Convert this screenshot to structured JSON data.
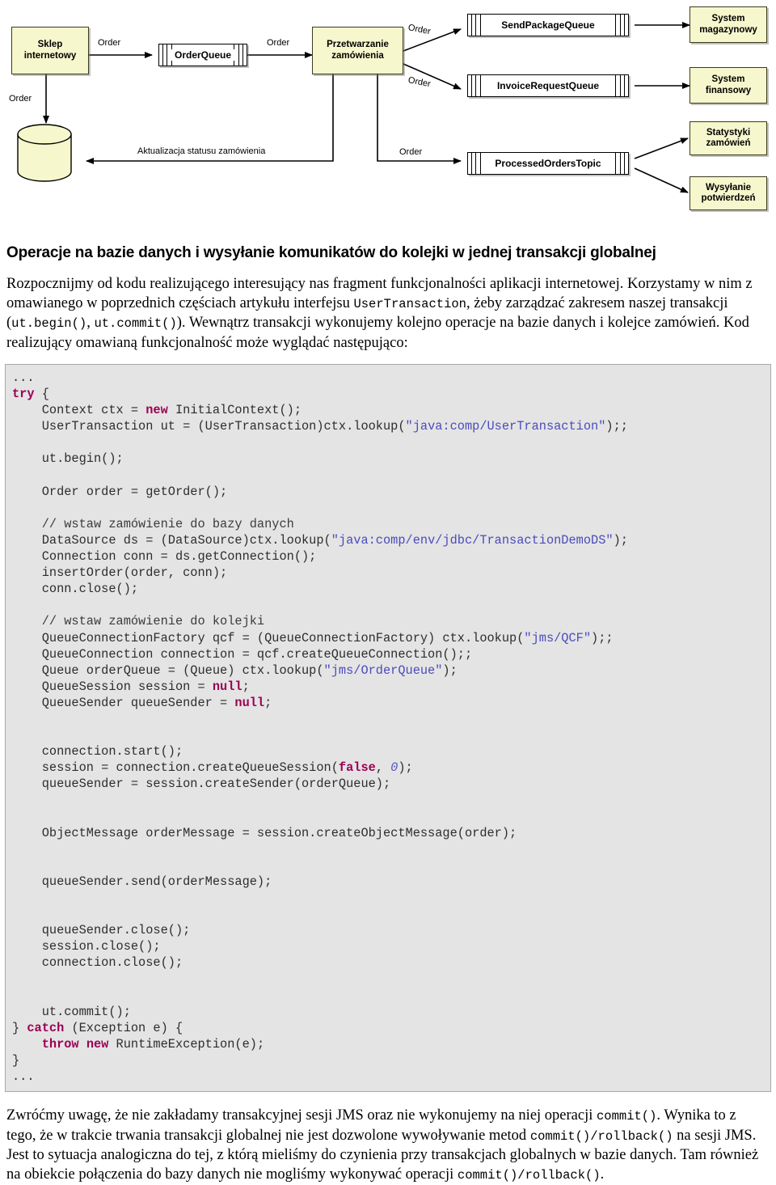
{
  "diagram": {
    "boxes": {
      "shop": "Sklep\ninternetowy",
      "shop_l1": "Sklep",
      "shop_l2": "internetowy",
      "processing_l1": "Przetwarzanie",
      "processing_l2": "zamówienia",
      "warehouse_l1": "System",
      "warehouse_l2": "magazynowy",
      "finance_l1": "System",
      "finance_l2": "finansowy",
      "stats_l1": "Statystyki",
      "stats_l2": "zamówień",
      "confirm_l1": "Wysyłanie",
      "confirm_l2": "potwierdzeń"
    },
    "queues": {
      "order_queue": "OrderQueue",
      "send_package_queue": "SendPackageQueue",
      "invoice_request_queue": "InvoiceRequestQueue",
      "processed_orders_topic": "ProcessedOrdersTopic"
    },
    "labels": {
      "order_1": "Order",
      "order_2": "Order",
      "order_3": "Order",
      "order_4": "Order",
      "order_5": "Order",
      "order_6": "Order",
      "status_update": "Aktualizacja statusu zamówienia"
    },
    "colors": {
      "box_fill": "#f7f7cd",
      "box_stroke": "#3a3a20",
      "queue_fill": "#ffffff",
      "line": "#000000"
    }
  },
  "article": {
    "section_title": "Operacje na bazie danych i wysyłanie komunikatów do kolejki w jednej transakcji globalnej",
    "intro_part1": "Rozpocznijmy od kodu realizującego interesujący nas fragment funkcjonalności aplikacji internetowej. Korzystamy w nim z omawianego w poprzednich częściach artykułu interfejsu ",
    "intro_code1": "UserTransaction",
    "intro_part2": ", żeby zarządzać zakresem naszej transakcji (",
    "intro_code2": "ut.begin()",
    "intro_part3": ", ",
    "intro_code3": "ut.commit()",
    "intro_part4": "). Wewnątrz transakcji wykonujemy kolejno operacje na bazie danych i kolejce zamówień. Kod realizujący omawianą funkcjonalność może wyglądać następująco:",
    "tail_part1": "Zwróćmy uwagę, że nie zakładamy transakcyjnej sesji JMS oraz nie wykonujemy na niej operacji ",
    "tail_code1": "commit()",
    "tail_part2": ". Wynika to z tego, że w trakcie trwania transakcji globalnej nie jest dozwolone wywoływanie metod ",
    "tail_code2": "commit()/rollback()",
    "tail_part3": " na sesji JMS. Jest to sytuacja analogiczna do tej, z którą mieliśmy do czynienia przy transakcjach globalnych w bazie danych. Tam również na obiekcie połączenia do bazy danych nie mogliśmy wykonywać operacji ",
    "tail_code3": "commit()/rollback()",
    "tail_part4": "."
  },
  "code_block": {
    "language": "java",
    "lines": [
      {
        "segments": [
          {
            "t": "...",
            "c": ""
          }
        ]
      },
      {
        "segments": [
          {
            "t": "try",
            "c": "kw"
          },
          {
            "t": " {",
            "c": ""
          }
        ]
      },
      {
        "segments": [
          {
            "t": "    Context ctx = ",
            "c": ""
          },
          {
            "t": "new",
            "c": "kw"
          },
          {
            "t": " InitialContext();",
            "c": ""
          }
        ]
      },
      {
        "segments": [
          {
            "t": "    UserTransaction ut = (UserTransaction)ctx.lookup(",
            "c": ""
          },
          {
            "t": "\"java:comp/UserTransaction\"",
            "c": "str"
          },
          {
            "t": ");;",
            "c": ""
          }
        ]
      },
      {
        "segments": [
          {
            "t": "",
            "c": ""
          }
        ]
      },
      {
        "segments": [
          {
            "t": "    ut.begin();",
            "c": ""
          }
        ]
      },
      {
        "segments": [
          {
            "t": "",
            "c": ""
          }
        ]
      },
      {
        "segments": [
          {
            "t": "    Order order = getOrder();",
            "c": ""
          }
        ]
      },
      {
        "segments": [
          {
            "t": "",
            "c": ""
          }
        ]
      },
      {
        "segments": [
          {
            "t": "    // wstaw zamówienie do bazy danych",
            "c": "cmt"
          }
        ]
      },
      {
        "segments": [
          {
            "t": "    DataSource ds = (DataSource)ctx.lookup(",
            "c": ""
          },
          {
            "t": "\"java:comp/env/jdbc/TransactionDemoDS\"",
            "c": "str"
          },
          {
            "t": ");",
            "c": ""
          }
        ]
      },
      {
        "segments": [
          {
            "t": "    Connection conn = ds.getConnection();",
            "c": ""
          }
        ]
      },
      {
        "segments": [
          {
            "t": "    insertOrder(order, conn);",
            "c": ""
          }
        ]
      },
      {
        "segments": [
          {
            "t": "    conn.close();",
            "c": ""
          }
        ]
      },
      {
        "segments": [
          {
            "t": "",
            "c": ""
          }
        ]
      },
      {
        "segments": [
          {
            "t": "    // wstaw zamówienie do kolejki",
            "c": "cmt"
          }
        ]
      },
      {
        "segments": [
          {
            "t": "    QueueConnectionFactory qcf = (QueueConnectionFactory) ctx.lookup(",
            "c": ""
          },
          {
            "t": "\"jms/QCF\"",
            "c": "str"
          },
          {
            "t": ");;",
            "c": ""
          }
        ]
      },
      {
        "segments": [
          {
            "t": "    QueueConnection connection = qcf.createQueueConnection();;",
            "c": ""
          }
        ]
      },
      {
        "segments": [
          {
            "t": "    Queue orderQueue = (Queue) ctx.lookup(",
            "c": ""
          },
          {
            "t": "\"jms/OrderQueue\"",
            "c": "str"
          },
          {
            "t": ");",
            "c": ""
          }
        ]
      },
      {
        "segments": [
          {
            "t": "    QueueSession session = ",
            "c": ""
          },
          {
            "t": "null",
            "c": "kw"
          },
          {
            "t": ";",
            "c": ""
          }
        ]
      },
      {
        "segments": [
          {
            "t": "    QueueSender queueSender = ",
            "c": ""
          },
          {
            "t": "null",
            "c": "kw"
          },
          {
            "t": ";",
            "c": ""
          }
        ]
      },
      {
        "segments": [
          {
            "t": "",
            "c": ""
          }
        ]
      },
      {
        "segments": [
          {
            "t": "",
            "c": ""
          }
        ]
      },
      {
        "segments": [
          {
            "t": "    connection.start();",
            "c": ""
          }
        ]
      },
      {
        "segments": [
          {
            "t": "    session = connection.createQueueSession(",
            "c": ""
          },
          {
            "t": "false",
            "c": "kw"
          },
          {
            "t": ", ",
            "c": ""
          },
          {
            "t": "0",
            "c": "num"
          },
          {
            "t": ");",
            "c": ""
          }
        ]
      },
      {
        "segments": [
          {
            "t": "    queueSender = session.createSender(orderQueue);",
            "c": ""
          }
        ]
      },
      {
        "segments": [
          {
            "t": "",
            "c": ""
          }
        ]
      },
      {
        "segments": [
          {
            "t": "",
            "c": ""
          }
        ]
      },
      {
        "segments": [
          {
            "t": "    ObjectMessage orderMessage = session.createObjectMessage(order);",
            "c": ""
          }
        ]
      },
      {
        "segments": [
          {
            "t": "",
            "c": ""
          }
        ]
      },
      {
        "segments": [
          {
            "t": "",
            "c": ""
          }
        ]
      },
      {
        "segments": [
          {
            "t": "    queueSender.send(orderMessage);",
            "c": ""
          }
        ]
      },
      {
        "segments": [
          {
            "t": "",
            "c": ""
          }
        ]
      },
      {
        "segments": [
          {
            "t": "",
            "c": ""
          }
        ]
      },
      {
        "segments": [
          {
            "t": "    queueSender.close();",
            "c": ""
          }
        ]
      },
      {
        "segments": [
          {
            "t": "    session.close();",
            "c": ""
          }
        ]
      },
      {
        "segments": [
          {
            "t": "    connection.close();",
            "c": ""
          }
        ]
      },
      {
        "segments": [
          {
            "t": "",
            "c": ""
          }
        ]
      },
      {
        "segments": [
          {
            "t": "",
            "c": ""
          }
        ]
      },
      {
        "segments": [
          {
            "t": "    ut.commit();",
            "c": ""
          }
        ]
      },
      {
        "segments": [
          {
            "t": "} ",
            "c": ""
          },
          {
            "t": "catch",
            "c": "kw"
          },
          {
            "t": " (Exception e) {",
            "c": ""
          }
        ]
      },
      {
        "segments": [
          {
            "t": "    ",
            "c": ""
          },
          {
            "t": "throw",
            "c": "kw"
          },
          {
            "t": " ",
            "c": ""
          },
          {
            "t": "new",
            "c": "kw"
          },
          {
            "t": " RuntimeException(e);",
            "c": ""
          }
        ]
      },
      {
        "segments": [
          {
            "t": "}",
            "c": ""
          }
        ]
      },
      {
        "segments": [
          {
            "t": "...",
            "c": ""
          }
        ]
      }
    ]
  }
}
